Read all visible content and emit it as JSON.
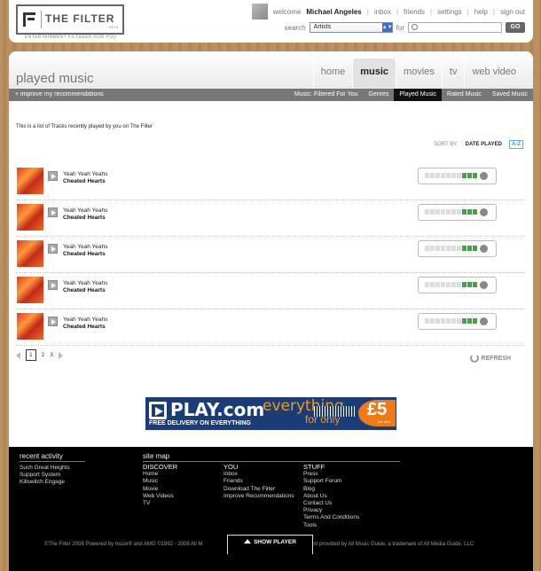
{
  "header": {
    "logo_text": "THE FILTER",
    "logo_beta": "BETA",
    "tagline": "ENTERTAINMENT FILTERED FOR YOU",
    "welcome": "welcome",
    "username": "Michael Angeles",
    "links": [
      "inbox",
      "friends",
      "settings",
      "help",
      "sign out"
    ],
    "search_label": "search",
    "search_category": "Artists",
    "for_label": "for",
    "search_value": "",
    "go_label": "GO"
  },
  "page": {
    "title": "played music",
    "tabs": [
      {
        "label": "home",
        "active": false
      },
      {
        "label": "music",
        "active": true
      },
      {
        "label": "movies",
        "active": false
      },
      {
        "label": "tv",
        "active": false
      },
      {
        "label": "web video",
        "active": false
      }
    ],
    "improve_link": "+ improve my recommendations",
    "subnav": [
      {
        "label": "Music: Filtered For You",
        "active": false
      },
      {
        "label": "Genres",
        "active": false
      },
      {
        "label": "Played Music",
        "active": true
      },
      {
        "label": "Rated Music",
        "active": false
      },
      {
        "label": "Saved Music",
        "active": false
      }
    ],
    "intro": "This is a list of Tracks recently played by you on The Filter",
    "sort_label": "SORT BY:",
    "sort_date": "DATE PLAYED",
    "sort_az": "A-Z"
  },
  "tracks": [
    {
      "artist": "Yeah Yeah Yeahs",
      "title": "Cheated Hearts",
      "rating": 0.7
    },
    {
      "artist": "Yeah Yeah Yeahs",
      "title": "Cheated Hearts",
      "rating": 0.7
    },
    {
      "artist": "Yeah Yeah Yeahs",
      "title": "Cheated Hearts",
      "rating": 0.7
    },
    {
      "artist": "Yeah Yeah Yeahs",
      "title": "Cheated Hearts",
      "rating": 0.7
    },
    {
      "artist": "Yeah Yeah Yeahs",
      "title": "Cheated Hearts",
      "rating": 0.7
    }
  ],
  "pagination": {
    "pages": [
      "1",
      "2",
      "3"
    ],
    "current": "1"
  },
  "refresh_label": "REFRESH",
  "ad": {
    "brand": "PLAY.com",
    "line1": "everything",
    "line2": "for only",
    "price": "£5",
    "price_note": "per item",
    "delivery": "FREE DELIVERY ON EVERYTHING"
  },
  "footer": {
    "recent_heading": "recent activity",
    "recent_items": [
      "Such Great Heights",
      "Support System",
      "Killswitch Engage"
    ],
    "sitemap_heading": "site map",
    "discover_heading": "DISCOVER",
    "discover": [
      "Home",
      "Music",
      "Movie",
      "Web Videos",
      "TV"
    ],
    "you_heading": "YOU",
    "you": [
      "Inbox",
      "Friends",
      "Download The Filter",
      "Improve Recommendations"
    ],
    "stuff_heading": "STUFF",
    "stuff": [
      "Press",
      "Support Forum",
      "Blog",
      "About Us",
      "Contact Us",
      "Privacy",
      "Terms And Conditions",
      "Tools"
    ],
    "copyright_left": "©The Filter 2008 Powered by muze® and AMG ©1992 - 2008 All M",
    "copyright_right": "ent provided by All Music Guide, a trademark of All Media Guide, LLC",
    "show_player": "SHOW PLAYER"
  }
}
